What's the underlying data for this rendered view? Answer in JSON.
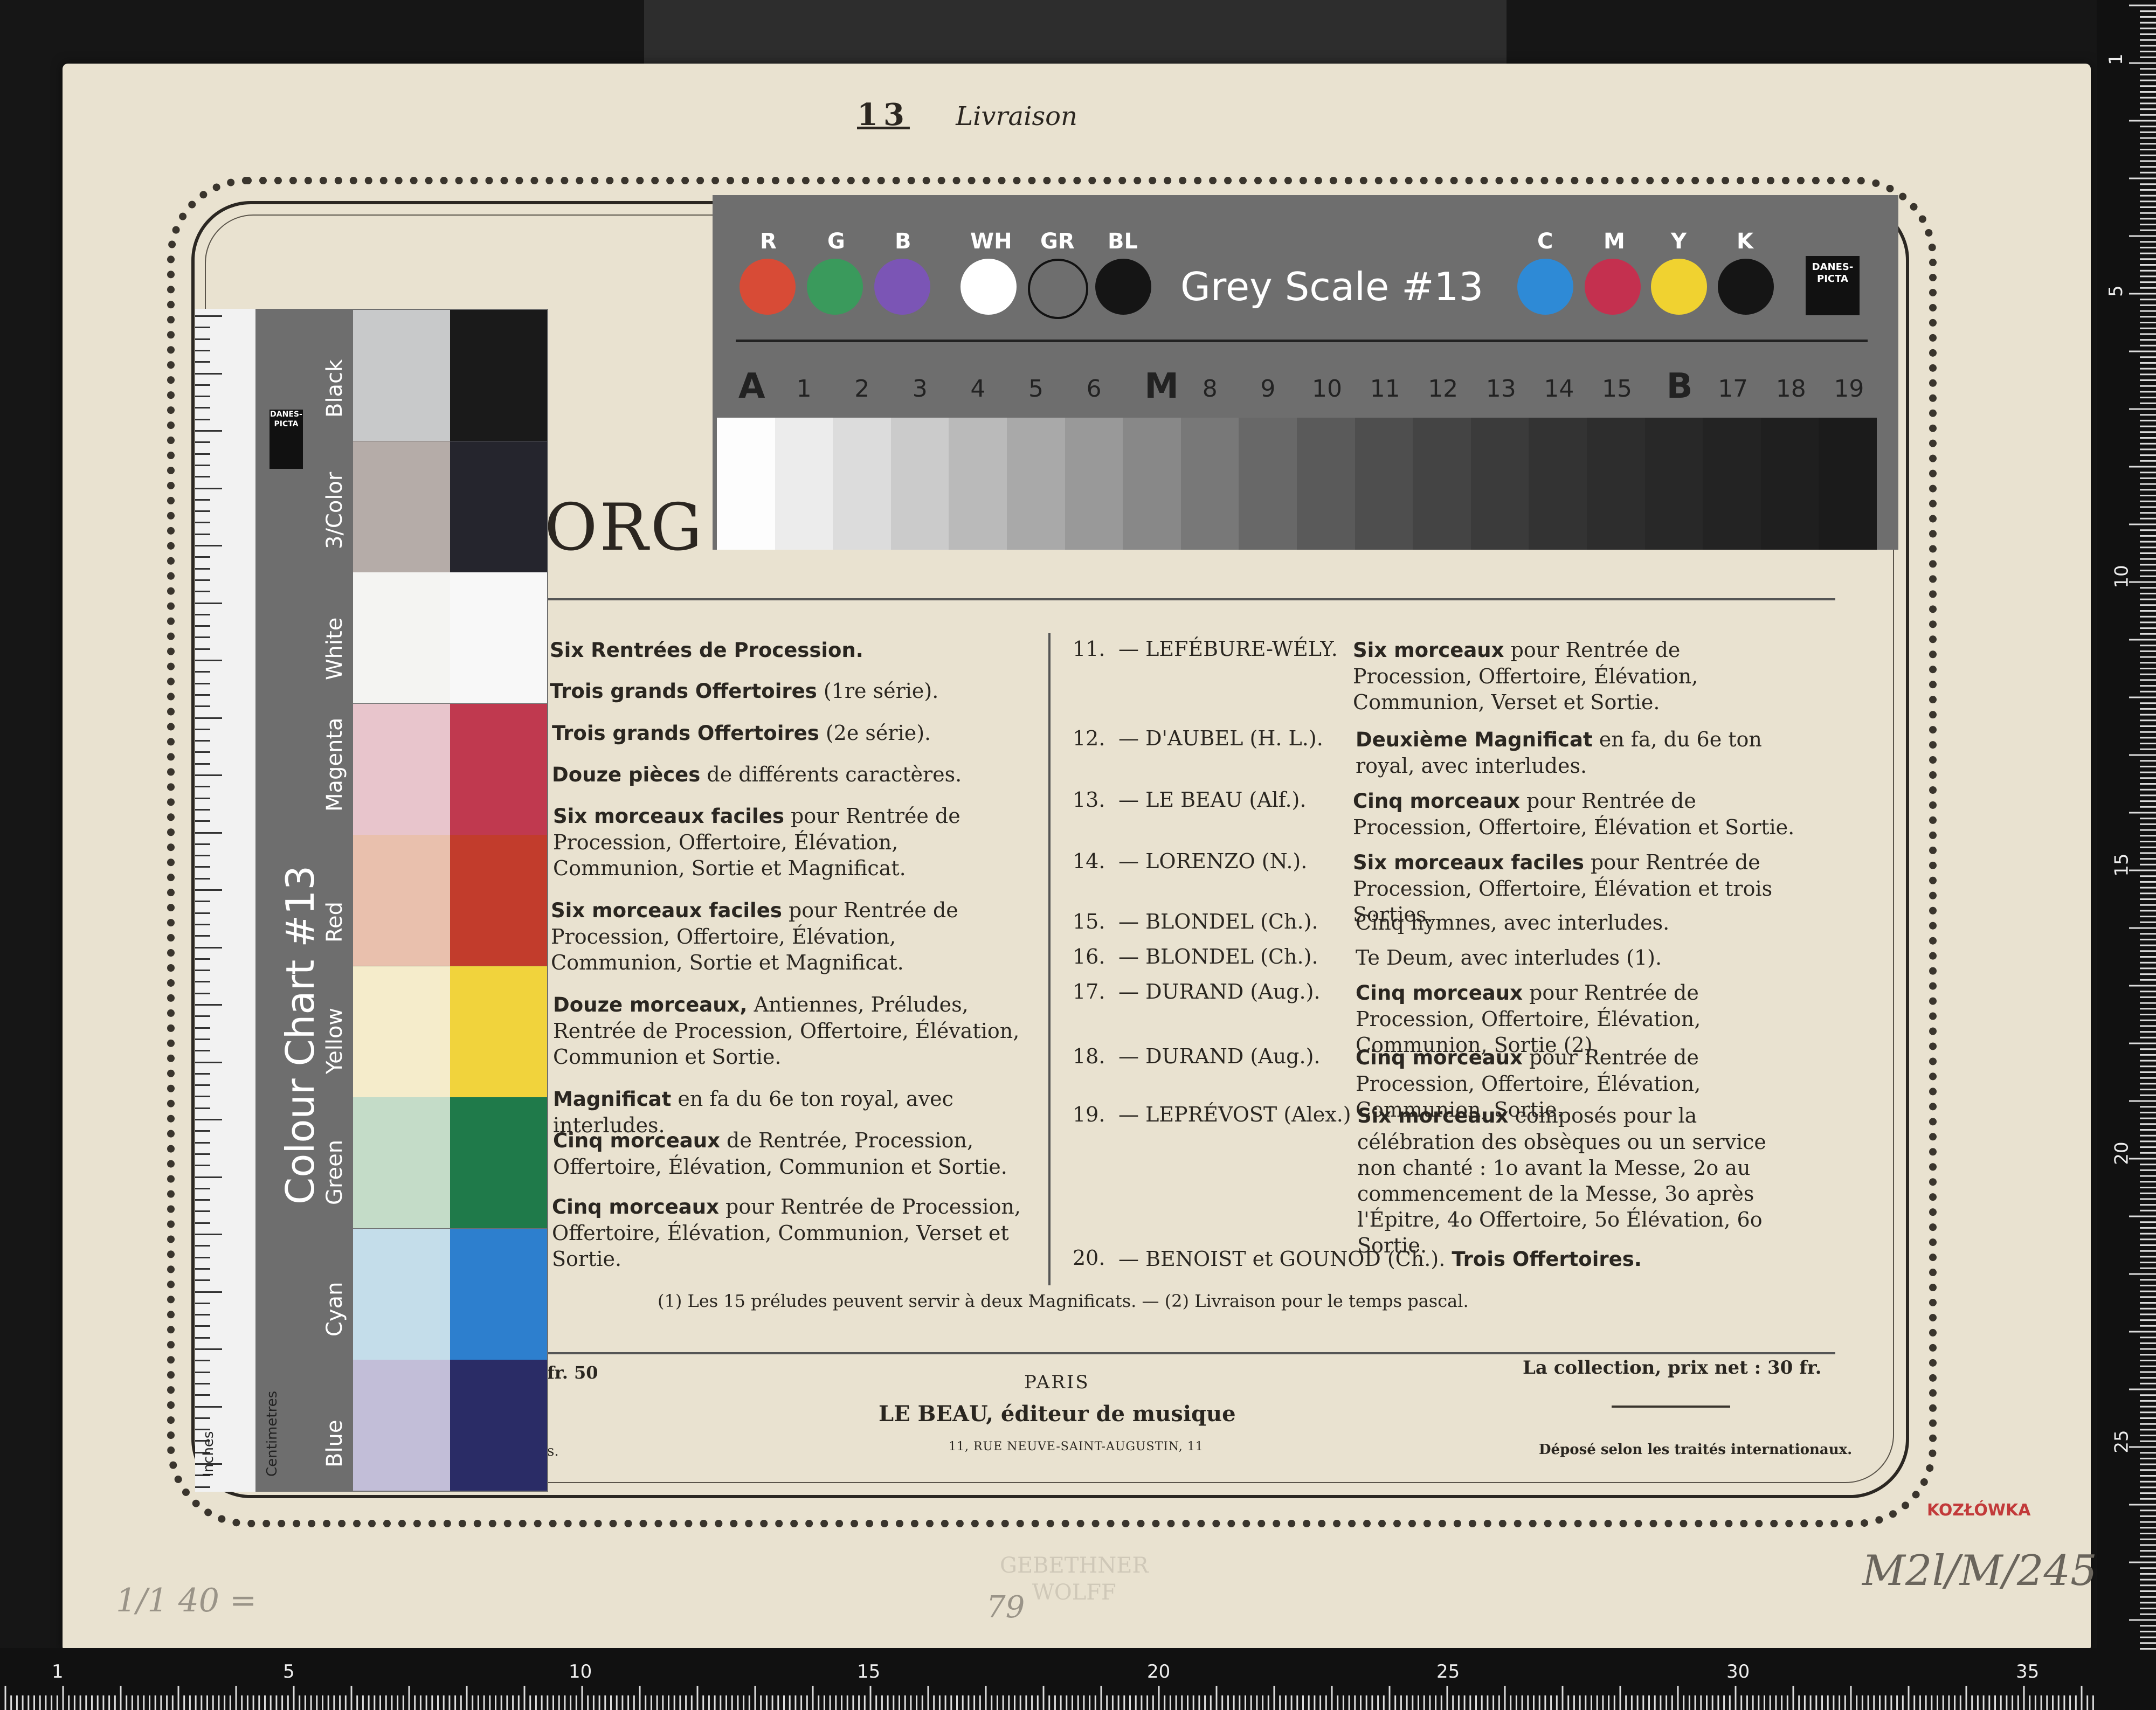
{
  "header": {
    "number": "13",
    "word": "Livraison"
  },
  "title_fragment": "ORG",
  "left_list": [
    {
      "bold": "Six Rentrées de Procession.",
      "rest": ""
    },
    {
      "bold": "Trois grands Offertoires",
      "rest": " (1re série)."
    },
    {
      "bold": "Trois grands Offertoires",
      "rest": " (2e série)."
    },
    {
      "bold": "Douze pièces",
      "rest": " de différents caractères."
    },
    {
      "bold": "Six morceaux faciles",
      "rest": " pour Rentrée de Procession, Offertoire, Élévation, Communion, Sortie et Magnificat."
    },
    {
      "bold": "Six morceaux faciles",
      "rest": " pour Rentrée de Procession, Offertoire, Élévation, Communion, Sortie et Magnificat."
    },
    {
      "bold": "Douze morceaux,",
      "rest": " Antiennes, Préludes, Rentrée de Procession, Offertoire, Élévation, Communion et Sortie."
    },
    {
      "bold": "Magnificat",
      "rest": " en fa du 6e ton royal, avec interludes."
    },
    {
      "bold": "Cinq morceaux",
      "rest": " de Rentrée, Procession, Offertoire, Élévation, Communion et Sortie."
    },
    {
      "bold": "Cinq morceaux",
      "rest": " pour Rentrée de Procession, Offertoire, Élévation, Communion, Verset et Sortie."
    }
  ],
  "right_list": [
    {
      "num": "11.",
      "composer": "— LEFÉBURE-WÉLY.",
      "bold": "Six morceaux",
      "rest": " pour Rentrée de Procession, Offertoire, Élévation, Communion, Verset et Sortie."
    },
    {
      "num": "12.",
      "composer": "— D'AUBEL (H. L.).",
      "bold": "Deuxième Magnificat",
      "rest": " en fa, du 6e ton royal, avec interludes."
    },
    {
      "num": "13.",
      "composer": "— LE BEAU (Alf.).",
      "bold": "Cinq morceaux",
      "rest": " pour Rentrée de Procession, Offertoire, Élévation et Sortie."
    },
    {
      "num": "14.",
      "composer": "— LORENZO (N.).",
      "bold": "Six morceaux faciles",
      "rest": " pour Rentrée de Procession, Offertoire, Élévation et trois Sorties."
    },
    {
      "num": "15.",
      "composer": "— BLONDEL (Ch.).",
      "bold": "",
      "rest": "Cinq hymnes, avec interludes."
    },
    {
      "num": "16.",
      "composer": "— BLONDEL (Ch.).",
      "bold": "",
      "rest": "Te Deum, avec interludes (1)."
    },
    {
      "num": "17.",
      "composer": "— DURAND (Aug.).",
      "bold": "Cinq morceaux",
      "rest": " pour Rentrée de Procession, Offertoire, Élévation, Communion, Sortie (2)."
    },
    {
      "num": "18.",
      "composer": "— DURAND (Aug.).",
      "bold": "Cinq morceaux",
      "rest": " pour Rentrée de Procession, Offertoire, Élévation, Communion, Sortie."
    },
    {
      "num": "19.",
      "composer": "— LEPRÉVOST (Alex.)",
      "bold": "Six morceaux",
      "rest": " composés pour la célébration des obsèques ou un service non chanté : 1o avant la Messe, 2o au commencement de la Messe, 3o après l'Épitre, 4o Offertoire, 5o Élévation, 6o Sortie."
    },
    {
      "num": "20.",
      "composer": "— BENOIST et GOUNOD (Ch.).",
      "bold": "Trois Offertoires.",
      "rest": ""
    }
  ],
  "footnote": "(1) Les 15 préludes peuvent servir à deux Magnificats. — (2) Livraison pour le temps pascal.",
  "footer": {
    "price_left": "fr. 50",
    "paris": "PARIS",
    "publisher": "LE BEAU, éditeur de musique",
    "address": "11, RUE NEUVE-SAINT-AUGUSTIN, 11",
    "collection_price": "La collection, prix net : 30 fr.",
    "depose": "Déposé selon les traités internationaux.",
    "price_left_tail": "s."
  },
  "annotations": {
    "pencil_left": "1/1 40 =",
    "pencil_center": "79",
    "faded_stamp": "GEBETHNER\nWOLFF",
    "red_stamp": "KOZŁÓWKA",
    "call_number": "M2l/M/245"
  },
  "grey_scale": {
    "title": "Grey Scale #13",
    "top_labels": [
      "R",
      "G",
      "B",
      "WH",
      "GR",
      "BL",
      "C",
      "M",
      "Y",
      "K"
    ],
    "circle_colors": [
      "#d84b36",
      "#3a9a5c",
      "#7b55b5",
      "#ffffff",
      "#6e6e6e",
      "#151515",
      "#2e8ad6",
      "#c4304f",
      "#f0d230",
      "#151515"
    ],
    "steps": [
      "A",
      "1",
      "2",
      "3",
      "4",
      "5",
      "6",
      "M",
      "8",
      "9",
      "10",
      "11",
      "12",
      "13",
      "14",
      "15",
      "B",
      "17",
      "18",
      "19"
    ],
    "patch_colors": [
      "#fdfdfd",
      "#ececec",
      "#dcdcdc",
      "#cbcbcb",
      "#bababa",
      "#a9a9a9",
      "#999999",
      "#888888",
      "#787878",
      "#686868",
      "#5a5a5a",
      "#4e4e4e",
      "#444444",
      "#3b3b3b",
      "#333333",
      "#2d2d2d",
      "#282828",
      "#232323",
      "#1f1f1f",
      "#1b1b1b"
    ],
    "logo": "DANES-PICTA"
  },
  "colour_chart": {
    "title": "Colour Chart #13",
    "labels": [
      "Black",
      "3/Color",
      "White",
      "Magenta",
      "Red",
      "Yellow",
      "Green",
      "Cyan",
      "Blue"
    ],
    "light_swatches": [
      "#c8c9ca",
      "#b5aca8",
      "#f4f4f2",
      "#e8c5cc",
      "#e9c0ad",
      "#f5eccb",
      "#c4dcc8",
      "#c4ddea",
      "#c2bed8"
    ],
    "dark_swatches": [
      "#1a1a1a",
      "#25252d",
      "#f8f8f8",
      "#c0394f",
      "#c23c2c",
      "#f1d33c",
      "#1f7a4a",
      "#2d7fce",
      "#2a2c66"
    ],
    "ruler_units": [
      "Inches",
      "Centimetres"
    ],
    "logo": "DANES-PICTA"
  },
  "bottom_ruler_labels": [
    "1",
    "5",
    "10",
    "15",
    "20",
    "25",
    "30",
    "35"
  ],
  "right_ruler_labels": [
    "1",
    "5",
    "10",
    "15",
    "20",
    "25"
  ]
}
